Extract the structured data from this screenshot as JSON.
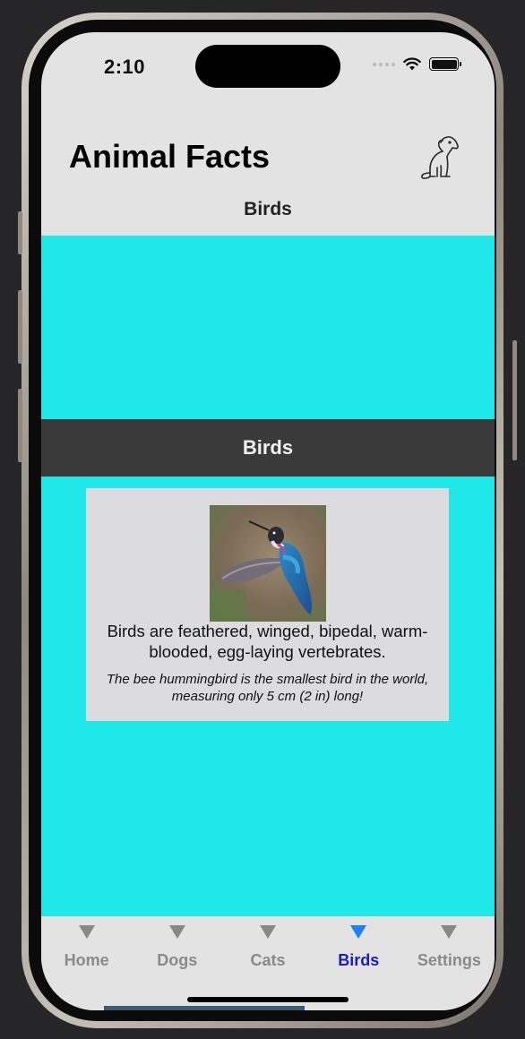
{
  "status_bar": {
    "time": "2:10"
  },
  "nav": {
    "title": "Animal Facts",
    "icon": "dog-icon",
    "section_title": "Birds"
  },
  "content": {
    "banner_title": "Birds",
    "card": {
      "image": "hummingbird-photo",
      "description": "Birds are feathered, winged, bipedal, warm-blooded, egg-laying vertebrates.",
      "fact": "The bee hummingbird is the smallest bird in the world, measuring only 5 cm (2 in) long!"
    }
  },
  "tabs": [
    {
      "label": "Home",
      "active": false
    },
    {
      "label": "Dogs",
      "active": false
    },
    {
      "label": "Cats",
      "active": false
    },
    {
      "label": "Birds",
      "active": true
    },
    {
      "label": "Settings",
      "active": false
    }
  ],
  "colors": {
    "content_bg": "#20e8e8",
    "banner_bg": "#3a3a3a",
    "active_tab_label": "#1a1ad2",
    "active_tab_arrow": "#1f7dff",
    "inactive_tab": "#8a8a8a"
  }
}
